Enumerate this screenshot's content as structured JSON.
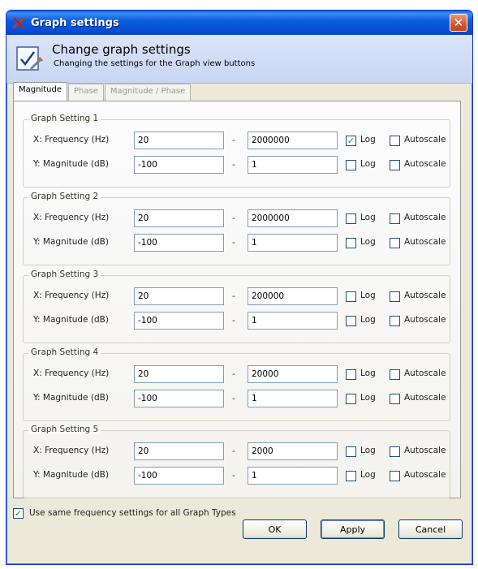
{
  "window": {
    "title": "Graph settings",
    "close_symbol": "✕",
    "title_icon": "app-x-icon",
    "accent": "#0650d8"
  },
  "header": {
    "title": "Change graph settings",
    "subtitle": "Changing the settings for the Graph view buttons",
    "icon": "settings-checklist-icon"
  },
  "tabs": [
    {
      "label": "Magnitude",
      "active": true
    },
    {
      "label": "Phase",
      "active": false
    },
    {
      "label": "Magnitude / Phase",
      "active": false
    }
  ],
  "groups": [
    {
      "label": "Graph Setting 1",
      "x": {
        "label": "X: Frequency (Hz)",
        "min": "20",
        "max": "2000000",
        "log": true,
        "autoscale": false
      },
      "y": {
        "label": "Y: Magnitude (dB)",
        "min": "-100",
        "max": "1",
        "log": false,
        "autoscale": false
      }
    },
    {
      "label": "Graph Setting 2",
      "x": {
        "label": "X: Frequency (Hz)",
        "min": "20",
        "max": "2000000",
        "log": false,
        "autoscale": false
      },
      "y": {
        "label": "Y: Magnitude (dB)",
        "min": "-100",
        "max": "1",
        "log": false,
        "autoscale": false
      }
    },
    {
      "label": "Graph Setting 3",
      "x": {
        "label": "X: Frequency (Hz)",
        "min": "20",
        "max": "200000",
        "log": false,
        "autoscale": false
      },
      "y": {
        "label": "Y: Magnitude (dB)",
        "min": "-100",
        "max": "1",
        "log": false,
        "autoscale": false
      }
    },
    {
      "label": "Graph Setting 4",
      "x": {
        "label": "X: Frequency (Hz)",
        "min": "20",
        "max": "20000",
        "log": false,
        "autoscale": false
      },
      "y": {
        "label": "Y: Magnitude (dB)",
        "min": "-100",
        "max": "1",
        "log": false,
        "autoscale": false
      }
    },
    {
      "label": "Graph Setting 5",
      "x": {
        "label": "X: Frequency (Hz)",
        "min": "20",
        "max": "2000",
        "log": false,
        "autoscale": false
      },
      "y": {
        "label": "Y: Magnitude (dB)",
        "min": "-100",
        "max": "1",
        "log": false,
        "autoscale": false
      }
    }
  ],
  "labels": {
    "dash": "-",
    "log": "Log",
    "autoscale": "Autoscale"
  },
  "same_frequency": {
    "label": "Use same frequency settings for all Graph Types",
    "checked": true
  },
  "buttons": {
    "ok": "OK",
    "apply": "Apply",
    "cancel": "Cancel"
  }
}
